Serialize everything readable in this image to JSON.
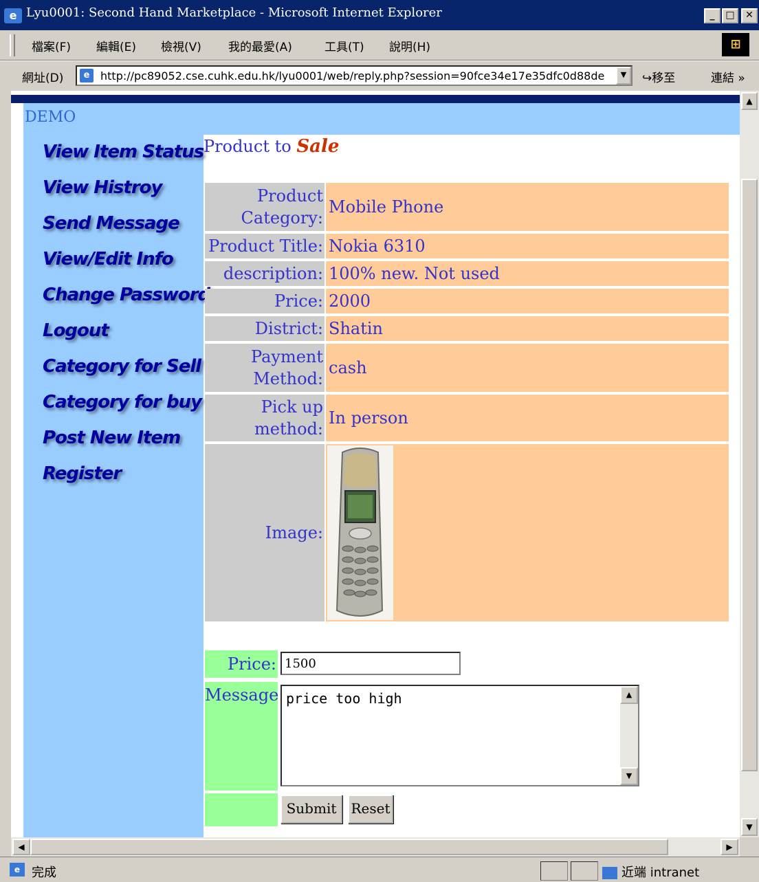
{
  "window": {
    "title": "Lyu0001: Second Hand Marketplace - Microsoft Internet Explorer",
    "app_icon": "ie-icon",
    "controls": [
      "minimize-icon",
      "maximize-icon",
      "close-icon"
    ]
  },
  "menu": {
    "items": [
      "檔案(F)",
      "編輯(E)",
      "檢視(V)",
      "我的最愛(A)",
      "工具(T)",
      "說明(H)"
    ]
  },
  "address": {
    "label": "網址(D)",
    "url": "http://pc89052.cse.cuhk.edu.hk/lyu0001/web/reply.php?session=90fce34e17e35dfc0d88de",
    "go": "移至",
    "links": "連結",
    "links_chevron": "»"
  },
  "page": {
    "demo": "DEMO",
    "nav": [
      "View Item Status",
      "View Histroy",
      "Send Message",
      "View/Edit Info",
      "Change Password",
      "Logout",
      "Category for Sell",
      "Category for buy",
      "Post New Item",
      "Register"
    ],
    "heading_prefix": "Product to ",
    "heading_emph": "Sale",
    "product": {
      "category_label": "Product Category:",
      "category_value": "Mobile Phone",
      "title_label": "Product Title:",
      "title_value": "Nokia 6310",
      "description_label": "description:",
      "description_value": "100% new. Not used",
      "price_label": "Price:",
      "price_value": "2000",
      "district_label": "District:",
      "district_value": "Shatin",
      "payment_label": "Payment Method:",
      "payment_value": "cash",
      "pickup_label": "Pick up method:",
      "pickup_value": "In person",
      "image_label": "Image:"
    },
    "reply": {
      "price_label": "Price:",
      "price_value": "1500",
      "message_label": "Message:",
      "message_value": "price too high",
      "submit": "Submit",
      "reset": "Reset"
    }
  },
  "status": {
    "text": "完成",
    "zone": "近端 intranet"
  },
  "colors": {
    "title_bar": "#08246b",
    "nav_bg": "#99ccff",
    "label_bg": "#cccccc",
    "value_bg": "#ffcc99",
    "form_label_bg": "#99ff99",
    "text_blue": "#3333cc",
    "sale_red": "#cc3300"
  }
}
